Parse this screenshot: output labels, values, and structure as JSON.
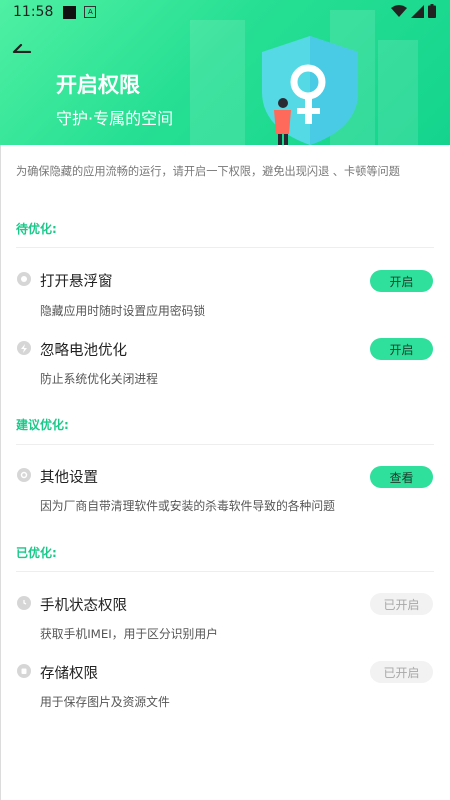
{
  "status_bar": {
    "time": "11:58"
  },
  "header": {
    "title": "开启权限",
    "subtitle": "守护·专属的空间",
    "accent_color": "#26df93"
  },
  "intro": "为确保隐藏的应用流畅的运行，请开启一下权限，避免出现闪退 、卡顿等问题",
  "sections": [
    {
      "title": "待优化:",
      "items": [
        {
          "title": "打开悬浮窗",
          "desc": "隐藏应用时随时设置应用密码锁",
          "button": "开启",
          "icon": "window-icon"
        },
        {
          "title": "忽略电池优化",
          "desc": "防止系统优化关闭进程",
          "button": "开启",
          "icon": "battery-icon"
        }
      ]
    },
    {
      "title": "建议优化:",
      "items": [
        {
          "title": "其他设置",
          "desc": "因为厂商自带清理软件或安装的杀毒软件导致的各种问题",
          "button": "查看",
          "icon": "settings-icon"
        }
      ]
    },
    {
      "title": "已优化:",
      "items": [
        {
          "title": "手机状态权限",
          "desc": "获取手机IMEI，用于区分识别用户",
          "button": "已开启",
          "icon": "phone-state-icon"
        },
        {
          "title": "存储权限",
          "desc": "用于保存图片及资源文件",
          "button": "已开启",
          "icon": "storage-icon"
        }
      ]
    }
  ]
}
